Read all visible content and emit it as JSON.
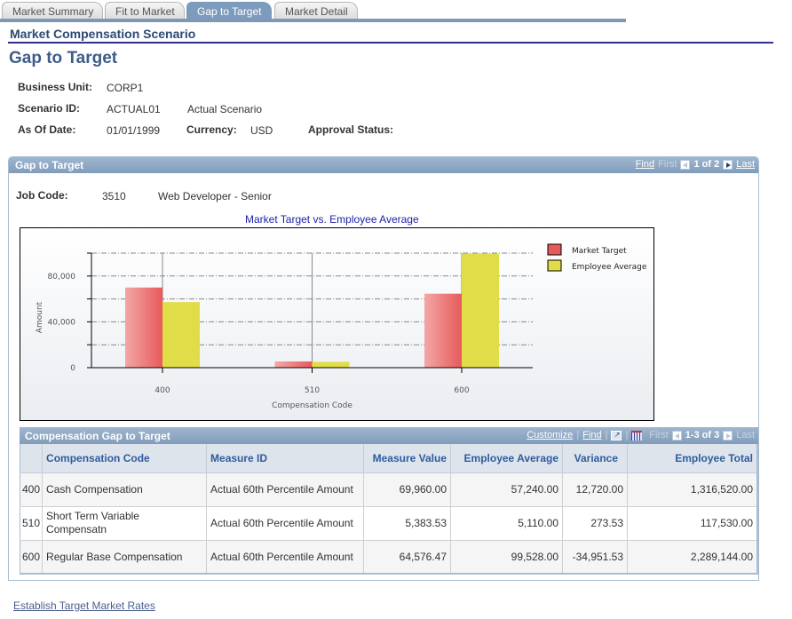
{
  "tabs": [
    {
      "label": "Market Summary",
      "active": false
    },
    {
      "label": "Fit to Market",
      "active": false
    },
    {
      "label": "Gap to Target",
      "active": true
    },
    {
      "label": "Market Detail",
      "active": false
    }
  ],
  "component_title": "Market Compensation Scenario",
  "page_title": "Gap to Target",
  "header": {
    "business_unit_label": "Business Unit:",
    "business_unit": "CORP1",
    "scenario_id_label": "Scenario ID:",
    "scenario_id": "ACTUAL01",
    "scenario_desc": "Actual Scenario",
    "as_of_date_label": "As Of Date:",
    "as_of_date": "01/01/1999",
    "currency_label": "Currency:",
    "currency": "USD",
    "approval_status_label": "Approval Status:"
  },
  "group": {
    "title": "Gap to Target",
    "nav": {
      "find": "Find",
      "first": "First",
      "count": "1 of 2",
      "last": "Last"
    },
    "job_code_label": "Job Code:",
    "job_code": "3510",
    "job_desc": "Web Developer - Senior"
  },
  "chart_data": {
    "type": "bar",
    "title": "Market Target vs. Employee Average",
    "xlabel": "Compensation Code",
    "ylabel": "Amount",
    "categories": [
      "400",
      "510",
      "600"
    ],
    "series": [
      {
        "name": "Market Target",
        "values": [
          69960.0,
          5383.53,
          64576.47
        ],
        "color": "#e85a5a"
      },
      {
        "name": "Employee Average",
        "values": [
          57240.0,
          5110.0,
          99528.0
        ],
        "color": "#e0dd48"
      }
    ],
    "ylim": [
      0,
      100000
    ],
    "yticks": [
      0,
      40000,
      80000
    ],
    "ytick_labels": [
      "0",
      "40,000",
      "80,000"
    ],
    "grid_step": 20000,
    "grid": true,
    "legend": "top-right"
  },
  "grid": {
    "title": "Compensation Gap to Target",
    "nav": {
      "customize": "Customize",
      "find": "Find",
      "first": "First",
      "count": "1-3 of 3",
      "last": "Last",
      "sep": "|"
    },
    "columns": [
      "",
      "Compensation Code",
      "Measure ID",
      "Measure Value",
      "Employee Average",
      "Variance",
      "Employee Total"
    ],
    "rows": [
      {
        "code": "400",
        "desc": "Cash Compensation",
        "measure": "Actual 60th Percentile Amount",
        "value": "69,960.00",
        "avg": "57,240.00",
        "variance": "12,720.00",
        "total": "1,316,520.00"
      },
      {
        "code": "510",
        "desc": "Short Term Variable Compensatn",
        "measure": "Actual 60th Percentile Amount",
        "value": "5,383.53",
        "avg": "5,110.00",
        "variance": "273.53",
        "total": "117,530.00"
      },
      {
        "code": "600",
        "desc": "Regular Base Compensation",
        "measure": "Actual 60th Percentile Amount",
        "value": "64,576.47",
        "avg": "99,528.00",
        "variance": "-34,951.53",
        "total": "2,289,144.00"
      }
    ]
  },
  "footer_link": "Establish Target Market Rates"
}
